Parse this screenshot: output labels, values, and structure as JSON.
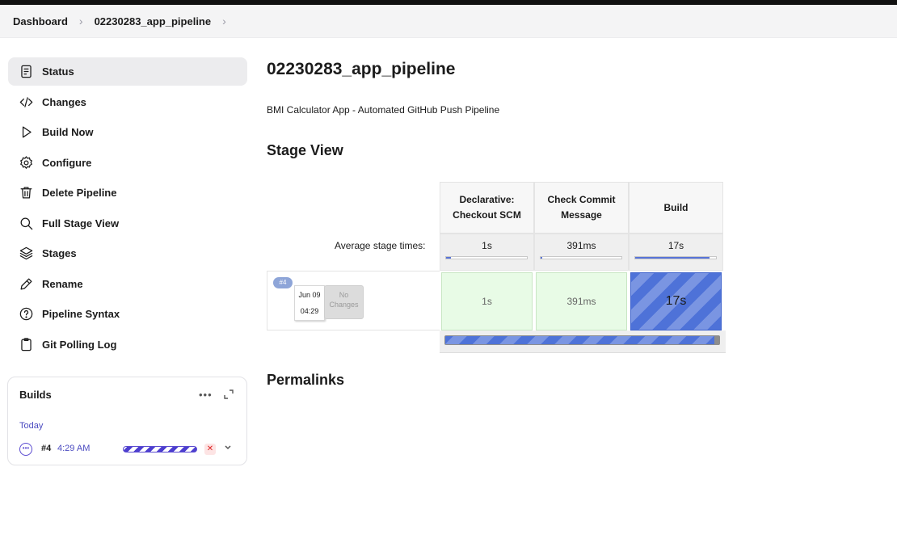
{
  "breadcrumb": {
    "items": [
      "Dashboard",
      "02230283_app_pipeline"
    ],
    "separator": "›"
  },
  "sidebar": {
    "items": [
      {
        "label": "Status",
        "icon": "document-icon",
        "active": true
      },
      {
        "label": "Changes",
        "icon": "code-icon"
      },
      {
        "label": "Build Now",
        "icon": "play-icon"
      },
      {
        "label": "Configure",
        "icon": "gear-icon"
      },
      {
        "label": "Delete Pipeline",
        "icon": "trash-icon"
      },
      {
        "label": "Full Stage View",
        "icon": "search-icon"
      },
      {
        "label": "Stages",
        "icon": "layers-icon"
      },
      {
        "label": "Rename",
        "icon": "pencil-icon"
      },
      {
        "label": "Pipeline Syntax",
        "icon": "help-icon"
      },
      {
        "label": "Git Polling Log",
        "icon": "clipboard-icon"
      }
    ]
  },
  "builds": {
    "title": "Builds",
    "more": "•••",
    "group": "Today",
    "rows": [
      {
        "number": "#4",
        "time": "4:29 AM",
        "cancel": "✕",
        "status": "•••"
      }
    ]
  },
  "main": {
    "title": "02230283_app_pipeline",
    "description": "BMI Calculator App - Automated GitHub Push Pipeline",
    "stage_view_heading": "Stage View",
    "permalinks_heading": "Permalinks"
  },
  "stage_view": {
    "avg_label": "Average stage times:",
    "stages": [
      {
        "name": "Declarative: Checkout SCM",
        "avg": "1s",
        "avg_fraction": 0.06
      },
      {
        "name": "Check Commit Message",
        "avg": "391ms",
        "avg_fraction": 0.02
      },
      {
        "name": "Build",
        "avg": "17s",
        "avg_fraction": 0.92
      }
    ],
    "runs": [
      {
        "badge": "#4",
        "date": "Jun 09",
        "time": "04:29",
        "changes": "No Changes",
        "cells": [
          {
            "value": "1s",
            "status": "success"
          },
          {
            "value": "391ms",
            "status": "success"
          },
          {
            "value": "17s",
            "status": "running"
          }
        ]
      }
    ]
  },
  "colors": {
    "accent": "#4c3ecf",
    "success_cell": "#e8fbe6",
    "running_cell": "#4e72d8",
    "cancel": "#dd2222"
  }
}
